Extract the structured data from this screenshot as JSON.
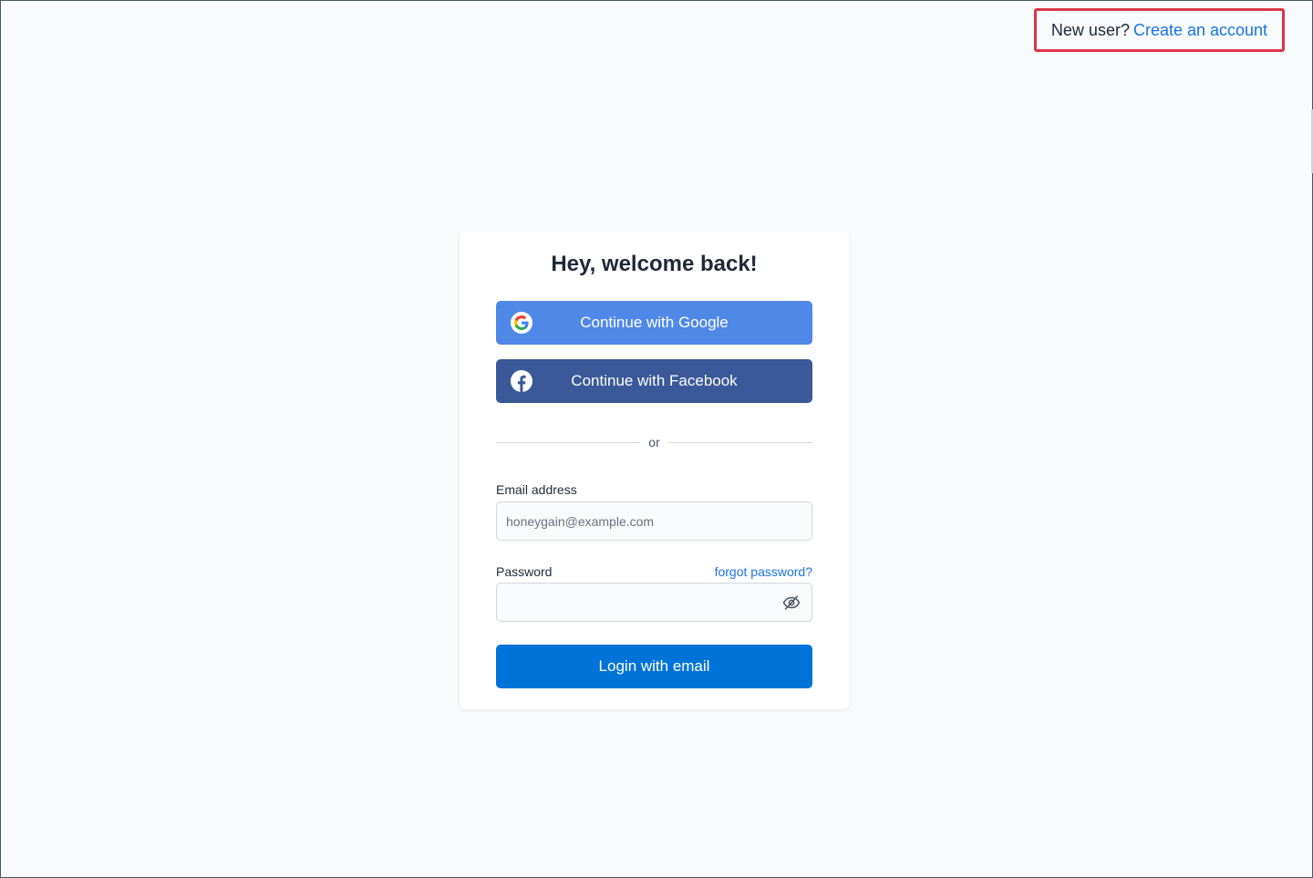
{
  "header": {
    "prompt": "New user?",
    "create_account_link": "Create an account"
  },
  "login": {
    "title": "Hey, welcome back!",
    "google_button": "Continue with Google",
    "facebook_button": "Continue with Facebook",
    "divider_text": "or",
    "email": {
      "label": "Email address",
      "placeholder": "honeygain@example.com",
      "value": ""
    },
    "password": {
      "label": "Password",
      "forgot_link": "forgot password?",
      "value": ""
    },
    "login_button": "Login with email"
  },
  "icons": {
    "google": "google-icon",
    "facebook": "facebook-icon",
    "password_toggle": "eye-off-icon"
  },
  "colors": {
    "google_button": "#5088e8",
    "facebook_button": "#3b5998",
    "login_button": "#0073d9",
    "link": "#1a73e8",
    "highlight_border": "#dc3545",
    "background": "#f8fafc"
  }
}
